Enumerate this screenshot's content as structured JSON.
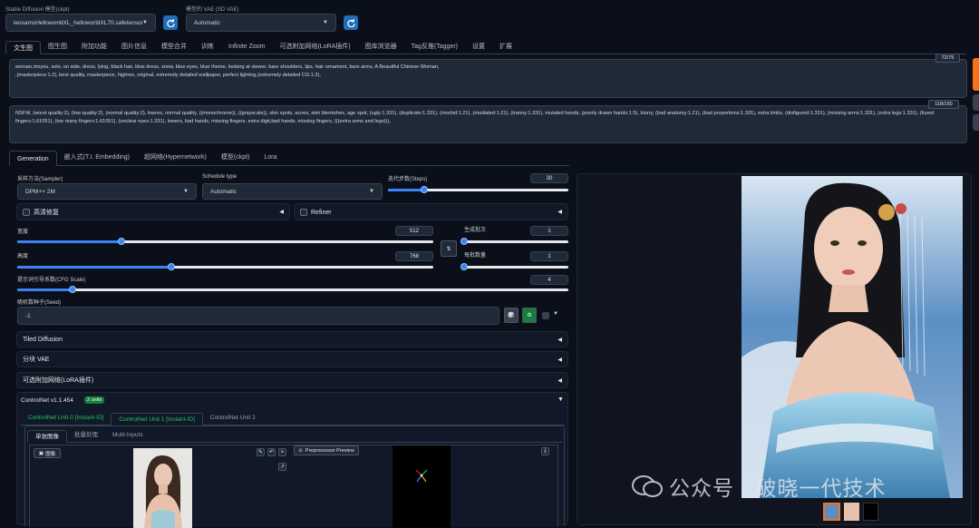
{
  "top": {
    "model_label": "Stable Diffusion 模型(ckpt)",
    "model_value": "leosamsHelloworldXL_helloworldXL70.safetensors",
    "vae_label": "模型的 VAE (SD VAE)",
    "vae_value": "Automatic",
    "refresh_icon": "refresh-icon"
  },
  "main_tabs": [
    "文生图",
    "图生图",
    "附加功能",
    "图片信息",
    "模型合并",
    "训练",
    "Infinite Zoom",
    "可选附加网络(LoRA插件)",
    "图库浏览器",
    "Tag反推(Tagger)",
    "设置",
    "扩展"
  ],
  "prompt": {
    "text": "woman,moyou, solo, on side, dress, lying, black hair, blue dress, snow, blue eyes, blue theme, looking at viewer, bare shoulders, lips, hair ornament, bare arms, A Beautiful Chinese Woman,\n,(masterpiece:1.2), best quality, masterpiece, highres, original, extremely detailed wallpaper, perfect lighting,(extremely detailed CG:1.2),",
    "counter": "72/75"
  },
  "negative": {
    "text": "NSFW, (worst quality:2), (low quality:2), (normal quality:2), lowres, normal quality, ((monochrome)), ((grayscale)), skin spots, acnes, skin blemishes, age spot, (ugly:1.331), (duplicate:1.331), (morbid:1.21), (mutilated:1.21), (tranny:1.331), mutated hands, (poorly drawn hands:1.5), blurry, (bad anatomy:1.21), (bad proportions:1.331), extra limbs, (disfigured:1.331), (missing arms:1.331), (extra legs:1.331), (fused fingers:1.61051), (too many fingers:1.61051), (unclear eyes:1.331), lowers, bad hands, missing fingers, extra digit,bad hands, missing fingers, (((extra arms and legs))),",
    "counter": "118/150"
  },
  "sub_tabs": [
    "Generation",
    "嵌入式(T.I. Embedding)",
    "超网络(Hypernetwork)",
    "模型(ckpt)",
    "Lora"
  ],
  "sampler": {
    "label": "采样方法(Sampler)",
    "value": "DPM++ 2M"
  },
  "schedule": {
    "label": "Schedule type",
    "value": "Automatic"
  },
  "steps": {
    "label": "迭代步数(Steps)",
    "value": "30",
    "fraction": 0.2
  },
  "hires": {
    "label": "高清修复"
  },
  "refiner": {
    "label": "Refiner"
  },
  "width": {
    "label": "宽度",
    "value": "512",
    "fraction": 0.25
  },
  "height": {
    "label": "高度",
    "value": "768",
    "fraction": 0.37
  },
  "batch_count": {
    "label": "生成批次",
    "value": "1",
    "fraction": 0.0
  },
  "batch_size": {
    "label": "每批数量",
    "value": "1",
    "fraction": 0.0
  },
  "swap_icon": "swap-icon",
  "cfg": {
    "label": "提示词引导系数(CFG Scale)",
    "value": "4",
    "fraction": 0.1
  },
  "seed": {
    "label": "随机数种子(Seed)",
    "value": "-1"
  },
  "accordions": [
    "Tiled Diffusion",
    "分块 VAE",
    "可选附加网络(LoRA插件)"
  ],
  "controlnet": {
    "title": "ControlNet v1.1.454",
    "badge": "2 units",
    "units": [
      "ControlNet Unit 0 [Instant-ID]",
      "ControlNet Unit 1 [Instant-ID]",
      "ControlNet Unit 2"
    ],
    "inner_tabs": [
      "单张图像",
      "批量处理",
      "Multi-Inputs"
    ],
    "image_label": "图像",
    "preview_btn": "Preprocessor Preview"
  },
  "watermark": "公众号 · 破晓一代技术",
  "colors": {
    "bg": "#0b0f19",
    "accent": "#1f6fb8",
    "active_tab": "#22c55e",
    "slider": "#3b82f6"
  }
}
